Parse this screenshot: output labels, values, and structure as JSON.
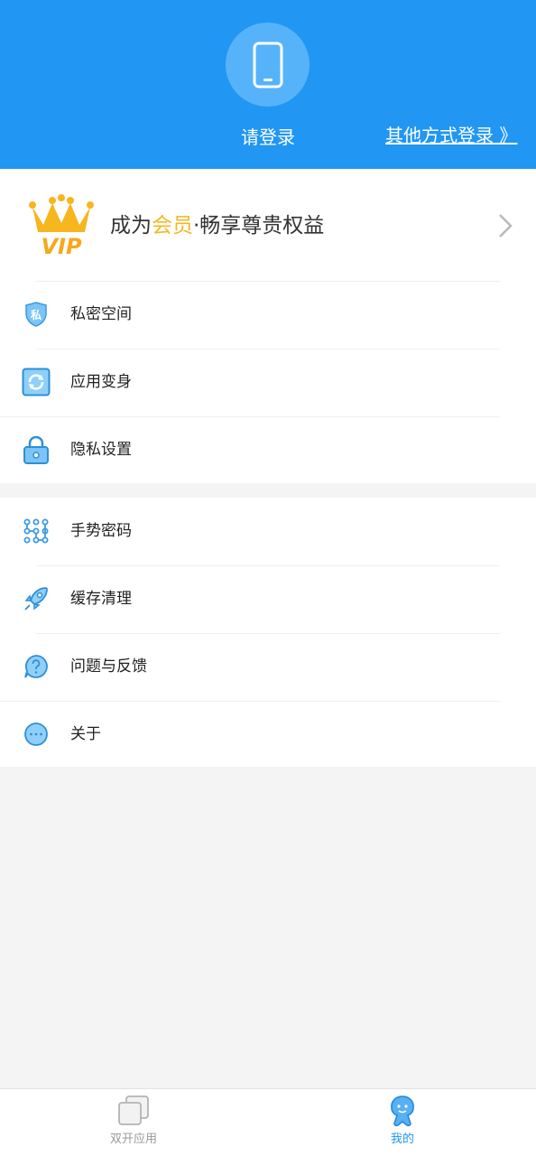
{
  "header": {
    "login_label": "请登录",
    "other_login": "其他方式登录 》",
    "accent_color": "#2196f3",
    "avatar_icon": "phone-icon"
  },
  "vip": {
    "badge_icon": "vip-crown-icon",
    "badge_text": "VIP",
    "text_prefix": "成为",
    "text_highlight": "会员",
    "text_suffix": "·畅享尊贵权益",
    "highlight_color": "#f5b820"
  },
  "menu_group_1": [
    {
      "label": "私密空间",
      "icon": "private-shield-icon",
      "icon_text": "私"
    },
    {
      "label": "应用变身",
      "icon": "app-transform-icon"
    },
    {
      "label": "隐私设置",
      "icon": "lock-icon"
    }
  ],
  "menu_group_2": [
    {
      "label": "手势密码",
      "icon": "gesture-grid-icon"
    },
    {
      "label": "缓存清理",
      "icon": "rocket-icon"
    },
    {
      "label": "问题与反馈",
      "icon": "question-bubble-icon"
    },
    {
      "label": "关于",
      "icon": "more-dots-icon"
    }
  ],
  "tabbar": {
    "tabs": [
      {
        "label": "双开应用",
        "icon": "dual-apps-icon",
        "active": false
      },
      {
        "label": "我的",
        "icon": "mine-person-icon",
        "active": true
      }
    ]
  }
}
